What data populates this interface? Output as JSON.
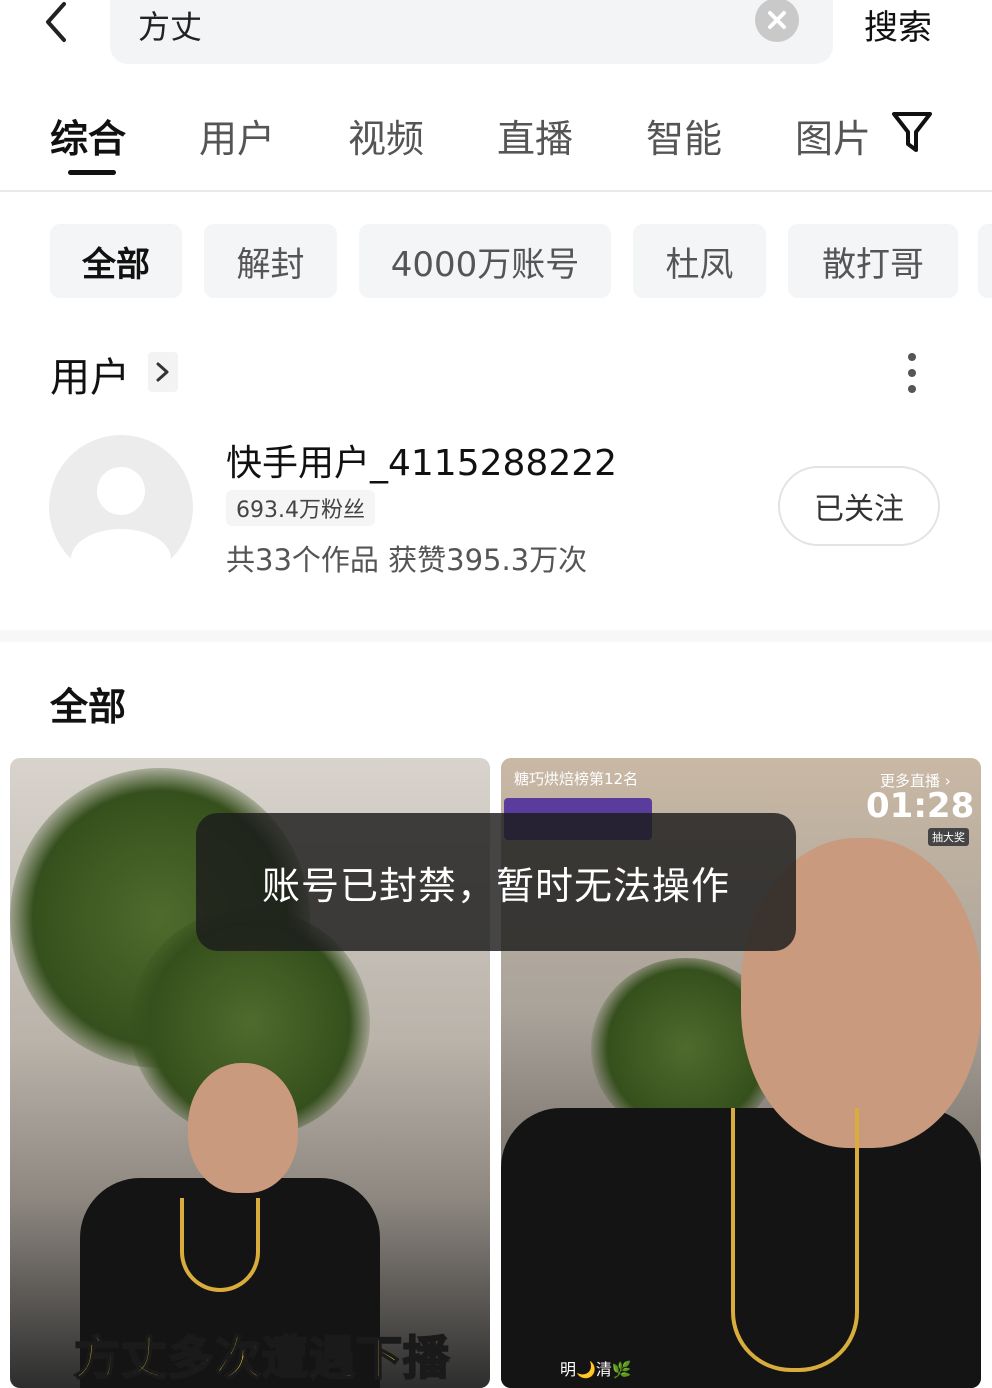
{
  "search": {
    "query": "方丈",
    "button_label": "搜索"
  },
  "tabs": [
    {
      "label": "综合",
      "active": true
    },
    {
      "label": "用户"
    },
    {
      "label": "视频"
    },
    {
      "label": "直播"
    },
    {
      "label": "智能"
    },
    {
      "label": "图片"
    }
  ],
  "chips": [
    {
      "label": "全部",
      "active": true
    },
    {
      "label": "解封"
    },
    {
      "label": "4000万账号"
    },
    {
      "label": "杜凤"
    },
    {
      "label": "散打哥"
    }
  ],
  "user_section": {
    "heading": "用户",
    "user": {
      "name": "快手用户_4115288222",
      "fans": "693.4万粉丝",
      "works_likes": "共33个作品 获赞395.3万次",
      "follow_label": "已关注"
    }
  },
  "all_section": {
    "heading": "全部"
  },
  "videos": {
    "left": {
      "caption": "方丈多次遭遇下播"
    },
    "right": {
      "rank_badge": "糖巧烘焙榜第12名",
      "more_live": "更多直播 ›",
      "timer": "01:28",
      "prize_label": "抽大奖",
      "streamer": "明🌙清🌿"
    }
  },
  "toast": {
    "message": "账号已封禁，暂时无法操作"
  },
  "colors": {
    "toast_bg": "#1c1c1c",
    "chip_bg": "#f4f5f7",
    "caption_yellow": "#ffe13a"
  }
}
